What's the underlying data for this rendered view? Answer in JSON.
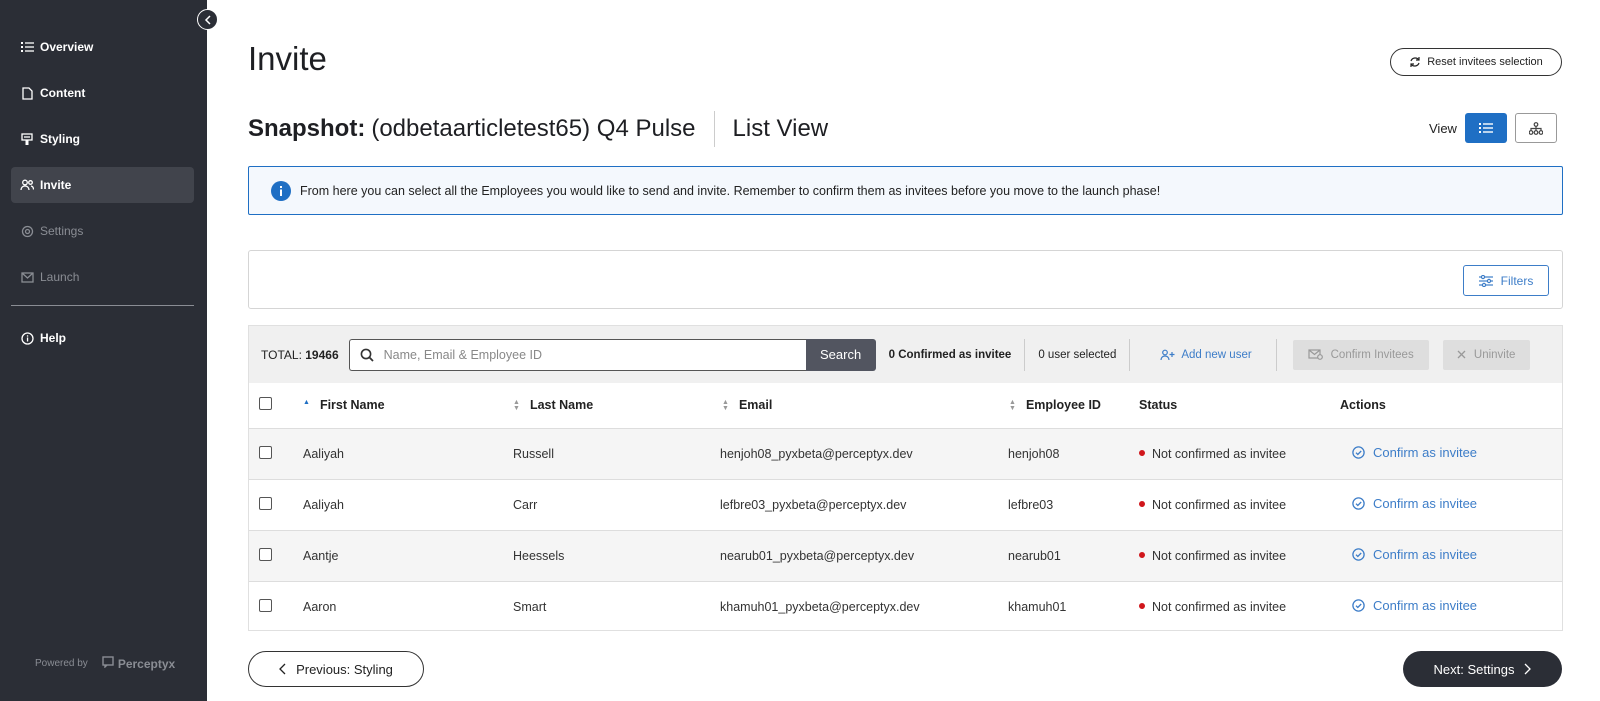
{
  "sidebar": {
    "items": [
      {
        "label": "Overview",
        "icon": "list-icon",
        "state": "normal"
      },
      {
        "label": "Content",
        "icon": "document-icon",
        "state": "normal"
      },
      {
        "label": "Styling",
        "icon": "brush-icon",
        "state": "normal"
      },
      {
        "label": "Invite",
        "icon": "users-icon",
        "state": "active"
      },
      {
        "label": "Settings",
        "icon": "gear-icon",
        "state": "disabled"
      },
      {
        "label": "Launch",
        "icon": "mail-icon",
        "state": "disabled"
      },
      {
        "label": "Help",
        "icon": "info-icon",
        "state": "normal"
      }
    ],
    "powered_by": "Powered by",
    "brand": "Perceptyx"
  },
  "header": {
    "title": "Invite",
    "reset_label": "Reset invitees selection"
  },
  "snapshot": {
    "label": "Snapshot:",
    "name": "(odbetaarticletest65) Q4 Pulse",
    "view_name": "List View",
    "view_label": "View"
  },
  "info": {
    "message": "From here you can select all the Employees you would like to send and invite. Remember to confirm them as invitees before you move to the launch phase!"
  },
  "filters": {
    "label": "Filters"
  },
  "toolbar": {
    "total_label": "TOTAL:",
    "total_value": "19466",
    "search_placeholder": "Name, Email & Employee ID",
    "search_label": "Search",
    "confirmed_count": "0 Confirmed as invitee",
    "selected_count": "0 user selected",
    "add_user_label": "Add new user",
    "confirm_invitees_label": "Confirm Invitees",
    "uninvite_label": "Uninvite"
  },
  "table": {
    "columns": [
      "First Name",
      "Last Name",
      "Email",
      "Employee ID",
      "Status",
      "Actions"
    ],
    "rows": [
      {
        "first": "Aaliyah",
        "last": "Russell",
        "email": "henjoh08_pyxbeta@perceptyx.dev",
        "id": "henjoh08",
        "status": "Not confirmed as invitee",
        "action": "Confirm as invitee"
      },
      {
        "first": "Aaliyah",
        "last": "Carr",
        "email": "lefbre03_pyxbeta@perceptyx.dev",
        "id": "lefbre03",
        "status": "Not confirmed as invitee",
        "action": "Confirm as invitee"
      },
      {
        "first": "Aantje",
        "last": "Heessels",
        "email": "nearub01_pyxbeta@perceptyx.dev",
        "id": "nearub01",
        "status": "Not confirmed as invitee",
        "action": "Confirm as invitee"
      },
      {
        "first": "Aaron",
        "last": "Smart",
        "email": "khamuh01_pyxbeta@perceptyx.dev",
        "id": "khamuh01",
        "status": "Not confirmed as invitee",
        "action": "Confirm as invitee"
      }
    ]
  },
  "footer": {
    "prev_label": "Previous: Styling",
    "next_label": "Next: Settings"
  },
  "colors": {
    "sidebar_bg": "#2b2e36",
    "accent_blue": "#1f6fc4",
    "status_red": "#d0161b"
  }
}
